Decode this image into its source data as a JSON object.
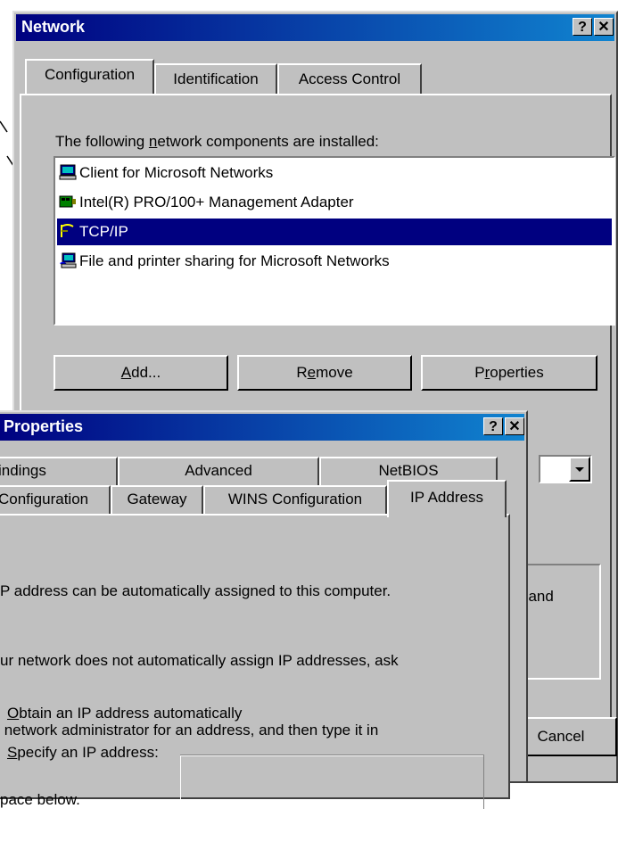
{
  "network_dialog": {
    "title": "Network",
    "tabs": [
      "Configuration",
      "Identification",
      "Access Control"
    ],
    "installed_label_pre": "The following ",
    "installed_label_key": "n",
    "installed_label_post": "etwork components are installed:",
    "components": [
      {
        "name": "Client for Microsoft Networks",
        "icon": "network-client-icon"
      },
      {
        "name": "Intel(R) PRO/100+ Management Adapter",
        "icon": "network-adapter-icon"
      },
      {
        "name": "TCP/IP",
        "icon": "protocol-icon",
        "selected": true
      },
      {
        "name": "File and printer sharing for Microsoft Networks",
        "icon": "file-sharing-icon"
      }
    ],
    "buttons": {
      "add_key": "A",
      "add_rest": "dd...",
      "remove_pre": "R",
      "remove_key": "e",
      "remove_rest": "move",
      "properties_pre": "P",
      "properties_key": "r",
      "properties_rest": "operties",
      "cancel": "Cancel"
    },
    "background_text": "t and"
  },
  "tcpip_dialog": {
    "title": "Properties",
    "tabs_row1": [
      "indings",
      "Advanced",
      "NetBIOS"
    ],
    "tabs_row2": [
      "Configuration",
      "Gateway",
      "WINS Configuration",
      "IP Address"
    ],
    "description": [
      "P address can be automatically assigned to this computer.",
      "ur network does not automatically assign IP addresses, ask",
      " network administrator for an address, and then type it in",
      "pace below."
    ],
    "obtain_key": "O",
    "obtain_rest": "btain an IP address automatically",
    "specify_key": "S",
    "specify_rest": "pecify an IP address:"
  },
  "colors": {
    "title_bar": "#000080",
    "selection": "#000080",
    "face": "#c0c0c0"
  }
}
